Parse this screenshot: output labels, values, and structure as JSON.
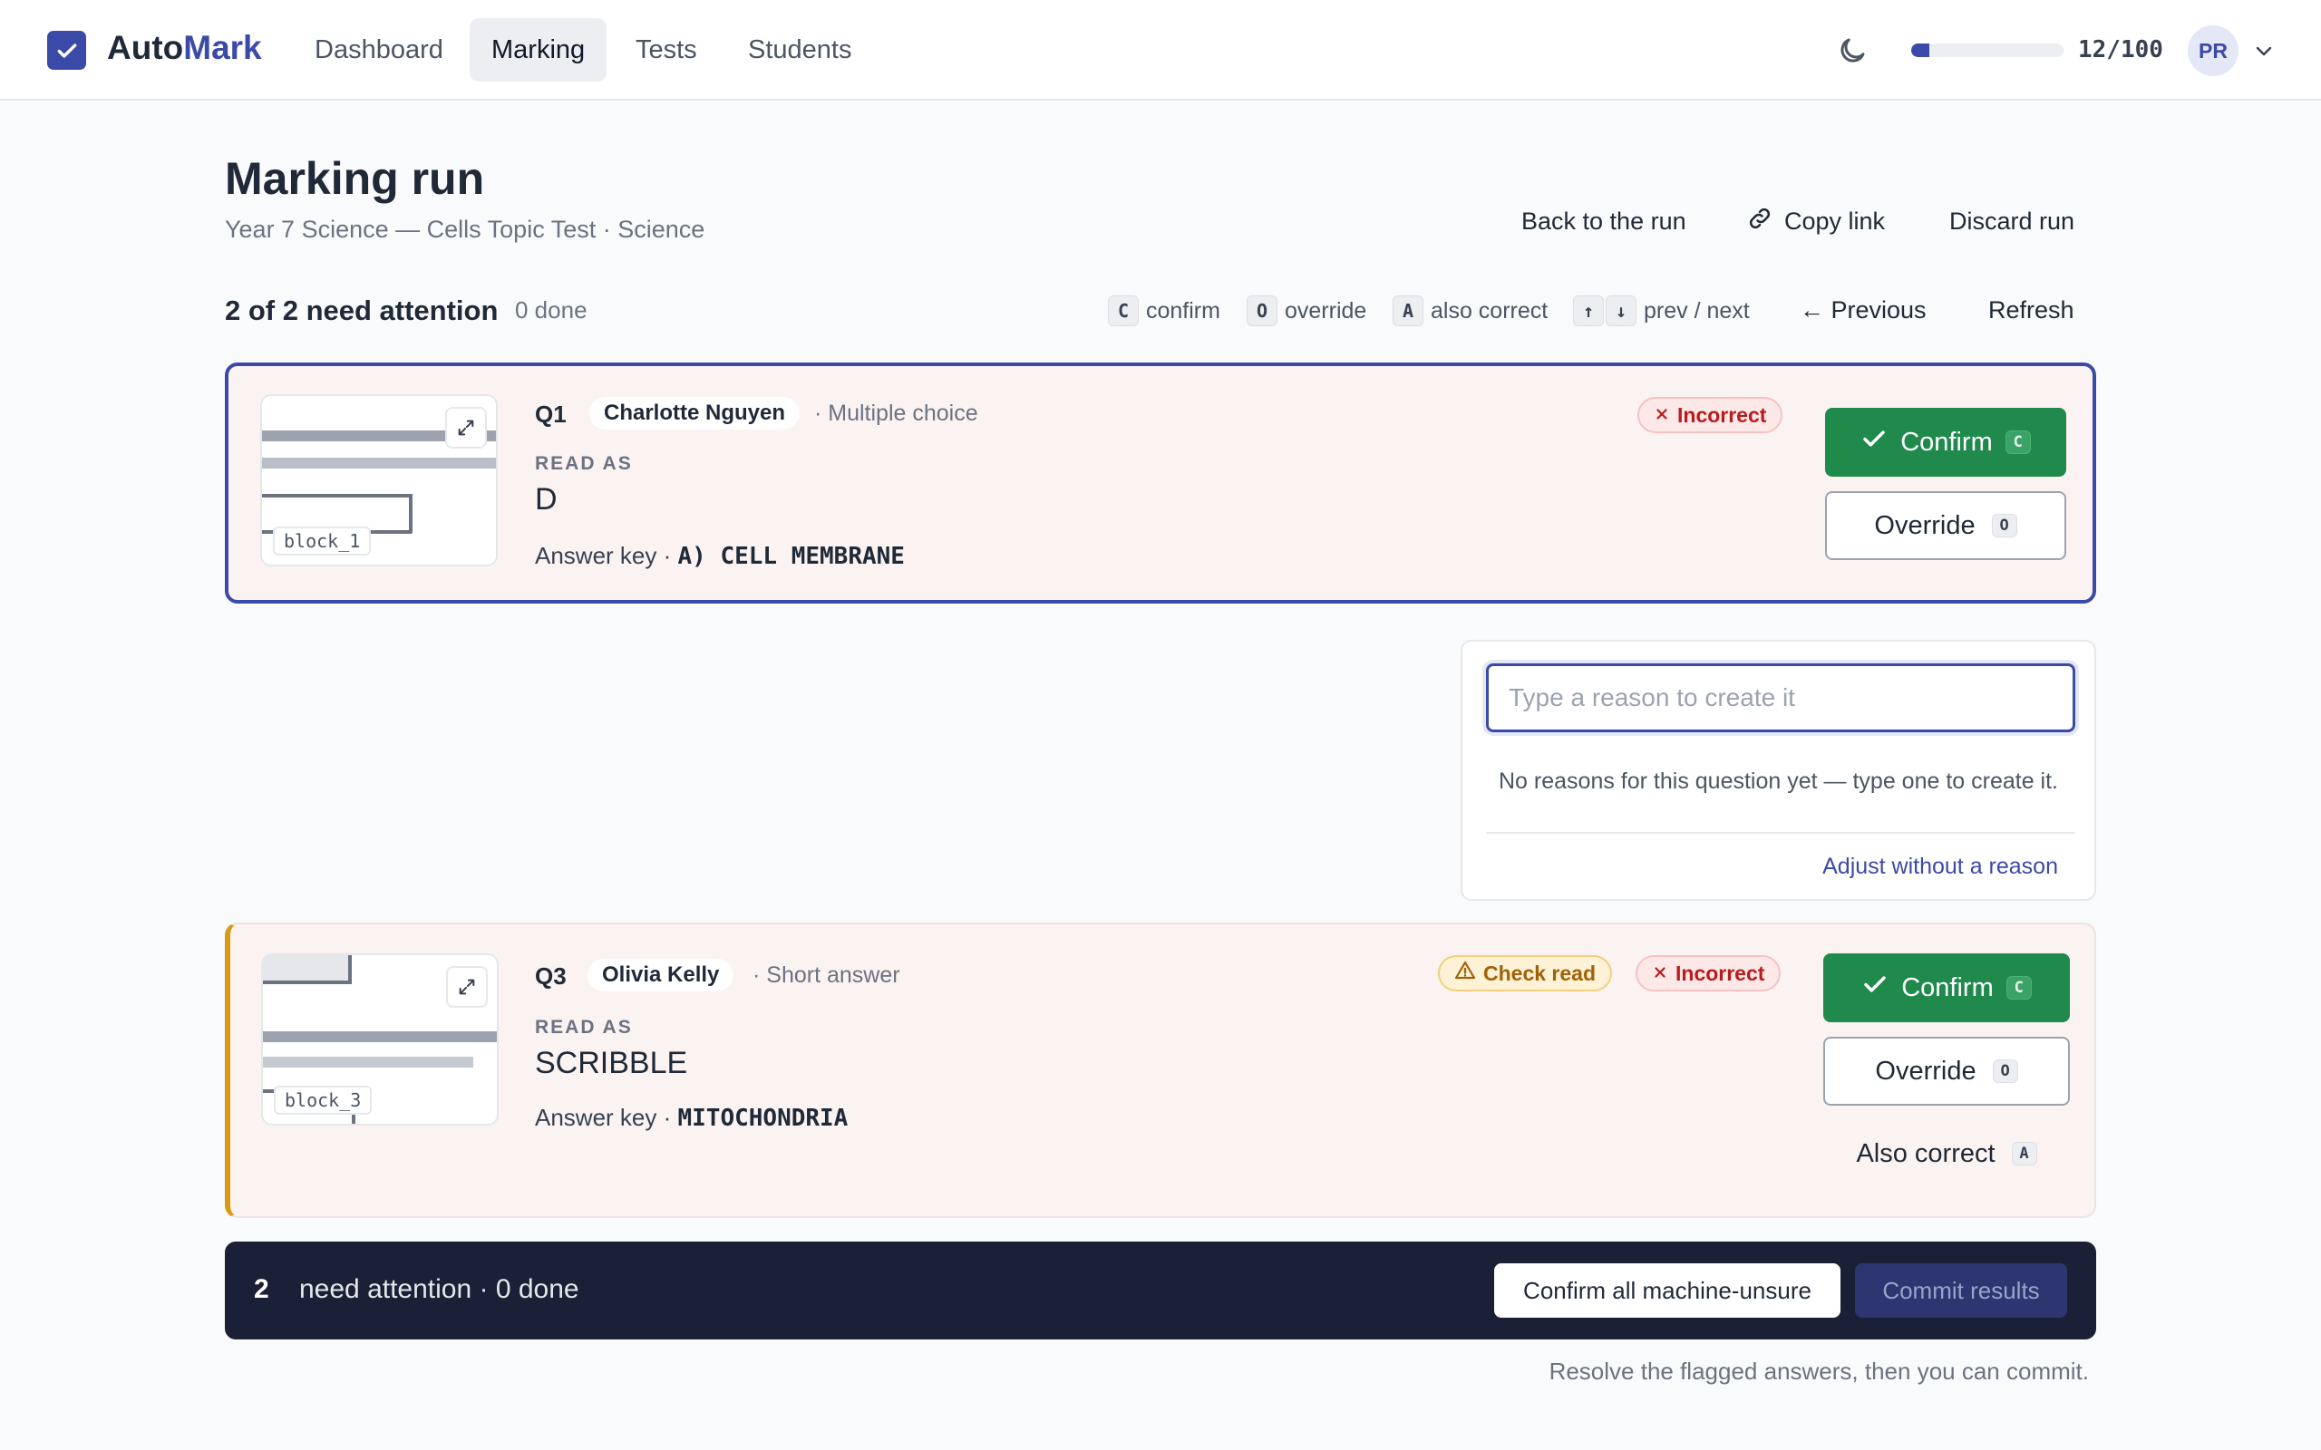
{
  "app": {
    "name_prefix": "Auto",
    "name_accent": "Mark",
    "accent_color": "#3b4aa8"
  },
  "nav": {
    "items": [
      {
        "label": "Dashboard",
        "active": false
      },
      {
        "label": "Marking",
        "active": true
      },
      {
        "label": "Tests",
        "active": false
      },
      {
        "label": "Students",
        "active": false
      }
    ]
  },
  "topbar": {
    "theme_icon": "moon-icon",
    "usage": {
      "label": "12/100",
      "used": 12,
      "total": 100
    },
    "avatar_initials": "PR"
  },
  "header": {
    "title": "Marking run",
    "subtitle": "Year 7 Science — Cells Topic Test · Science",
    "actions": {
      "back": "Back to the run",
      "copy": "Copy link",
      "discard": "Discard run"
    }
  },
  "summary": {
    "attention": "2 of 2 need attention",
    "done": "0 done",
    "hints": {
      "confirm_key": "C",
      "confirm": "confirm",
      "override_key": "O",
      "override": "override",
      "also_key": "A",
      "also": "also correct",
      "up_key": "↑",
      "down_key": "↓",
      "nav": "prev / next"
    },
    "previous": "← Previous",
    "refresh": "Refresh"
  },
  "items": [
    {
      "qnum": "Q1",
      "student": "Charlotte Nguyen",
      "type": "· Multiple choice",
      "read_as_label": "READ AS",
      "read_as": "D",
      "answer_key_label": "Answer key ·",
      "answer_key": "A) CELL MEMBRANE",
      "block": "block_1",
      "badges": {
        "incorrect": "Incorrect"
      },
      "confirm": "Confirm",
      "confirm_key": "C",
      "override": "Override",
      "override_key": "O"
    },
    {
      "qnum": "Q3",
      "student": "Olivia Kelly",
      "type": "· Short answer",
      "read_as_label": "READ AS",
      "read_as": "SCRIBBLE",
      "answer_key_label": "Answer key ·",
      "answer_key": "MITOCHONDRIA",
      "block": "block_3",
      "badges": {
        "check": "Check read",
        "incorrect": "Incorrect"
      },
      "confirm": "Confirm",
      "confirm_key": "C",
      "override": "Override",
      "override_key": "O",
      "also": "Also correct",
      "also_key": "A"
    }
  ],
  "reason_popover": {
    "placeholder": "Type a reason to create it",
    "empty": "No reasons for this question yet — type one to create it.",
    "adjust": "Adjust without a reason"
  },
  "footer": {
    "count": "2",
    "text": "need attention · 0 done",
    "confirm_all": "Confirm all machine-unsure",
    "commit": "Commit results",
    "note": "Resolve the flagged answers, then you can commit."
  }
}
